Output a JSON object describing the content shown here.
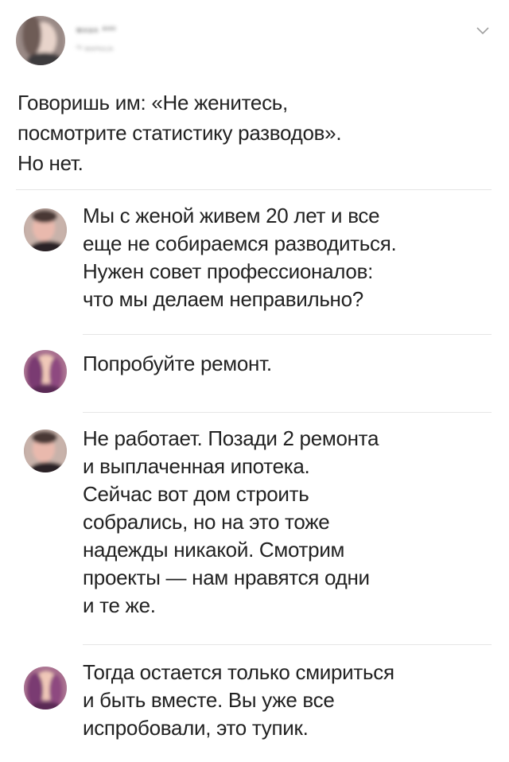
{
  "post": {
    "author_name": "ᴍᴀᴚᴀ ᴬᴴᴴ",
    "author_handle": "ᴴʸ ᴍᴀᴘᴋᴀᴊᴀ",
    "text": "Говоришь им: «Не женитесь,\nпосмотрите статистику разводов».\nНо нет."
  },
  "replies": [
    {
      "text": "Мы с женой живем 20 лет и все\nеще не собираемся разводиться.\nНужен совет профессионалов:\nчто мы делаем неправильно?"
    },
    {
      "text": "Попробуйте ремонт."
    },
    {
      "text": "Не работает. Позади 2 ремонта\nи выплаченная ипотека.\nСейчас вот дом строить\nсобрались, но на это тоже\nнадежды никакой. Смотрим\nпроекты — нам нравятся одни\nи те же."
    },
    {
      "text": "Тогда остается только смириться\nи быть вместе. Вы уже все\nиспробовали, это тупик."
    }
  ],
  "icons": {
    "menu": "chevron-down-icon"
  },
  "colors": {
    "divider": "#e6e6e6",
    "text": "#222222"
  }
}
